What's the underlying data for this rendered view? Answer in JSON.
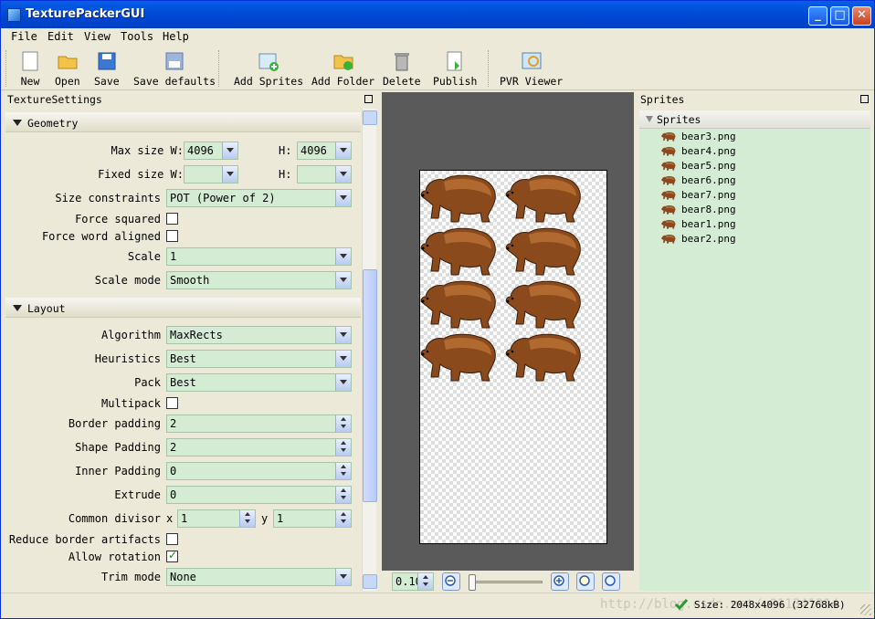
{
  "window": {
    "title": "TexturePackerGUI"
  },
  "menu": [
    "File",
    "Edit",
    "View",
    "Tools",
    "Help"
  ],
  "toolbar": {
    "new": "New",
    "open": "Open",
    "save": "Save",
    "save_defaults": "Save defaults",
    "add_sprites": "Add Sprites",
    "add_folder": "Add Folder",
    "delete": "Delete",
    "publish": "Publish",
    "pvr_viewer": "PVR Viewer"
  },
  "settings_panel": {
    "title": "TextureSettings",
    "geometry": {
      "header": "Geometry",
      "max_size_label": "Max size W:",
      "max_w": "4096",
      "h_label": "H:",
      "max_h": "4096",
      "fixed_size_label": "Fixed size W:",
      "fixed_w": "",
      "fixed_h": "",
      "size_constraints_label": "Size constraints",
      "size_constraints": "POT (Power of 2)",
      "force_squared_label": "Force squared",
      "force_word_label": "Force word aligned",
      "scale_label": "Scale",
      "scale": "1",
      "scale_mode_label": "Scale mode",
      "scale_mode": "Smooth"
    },
    "layout": {
      "header": "Layout",
      "algorithm_label": "Algorithm",
      "algorithm": "MaxRects",
      "heuristics_label": "Heuristics",
      "heuristics": "Best",
      "pack_label": "Pack",
      "pack": "Best",
      "multipack_label": "Multipack",
      "border_padding_label": "Border padding",
      "border_padding": "2",
      "shape_padding_label": "Shape Padding",
      "shape_padding": "2",
      "inner_padding_label": "Inner Padding",
      "inner_padding": "0",
      "extrude_label": "Extrude",
      "extrude": "0",
      "common_divisor_label": "Common divisor",
      "x_label": "x",
      "divisor_x": "1",
      "y_label": "y",
      "divisor_y": "1",
      "reduce_border_label": "Reduce border artifacts",
      "allow_rotation_label": "Allow rotation",
      "trim_mode_label": "Trim mode",
      "trim_mode": "None"
    }
  },
  "preview": {
    "zoom": "0.10"
  },
  "sprites_panel": {
    "title": "Sprites",
    "root": "Sprites",
    "items": [
      "bear3.png",
      "bear4.png",
      "bear5.png",
      "bear6.png",
      "bear7.png",
      "bear8.png",
      "bear1.png",
      "bear2.png"
    ]
  },
  "status": {
    "size": "Size: 2048x4096 (32768kB)",
    "watermark": "http://blog.csdn.net/u011341314"
  },
  "colors": {
    "field_bg": "#d4ecd4",
    "title_blue": "#0054e3",
    "bear_brown": "#8b4a1c"
  }
}
